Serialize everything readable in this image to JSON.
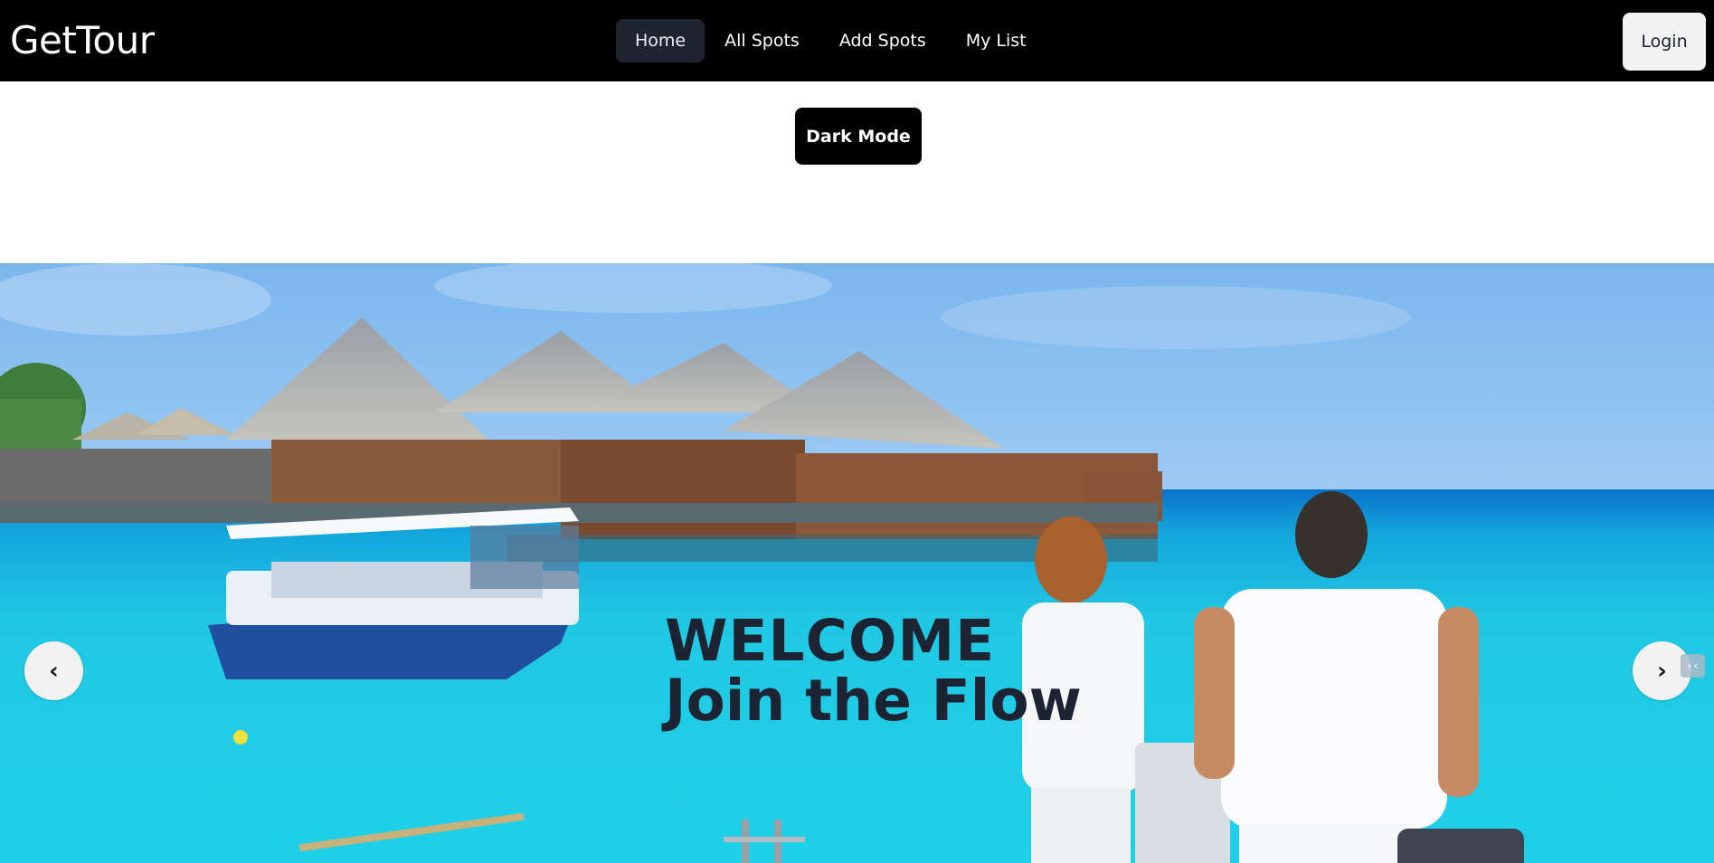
{
  "brand": {
    "name": "GetTour"
  },
  "nav": {
    "links": [
      {
        "label": "Home",
        "active": true
      },
      {
        "label": "All Spots",
        "active": false
      },
      {
        "label": "Add Spots",
        "active": false
      },
      {
        "label": "My List",
        "active": false
      }
    ],
    "login_label": "Login"
  },
  "theme_toggle": {
    "label": "Dark Mode"
  },
  "hero": {
    "line1": "WELCOME",
    "line2": "Join the Flow",
    "prev_glyph": "‹",
    "next_glyph": "›",
    "corner_glyph": "›‹"
  },
  "colors": {
    "navbar_bg": "#000000",
    "active_tab_bg": "#1f2430",
    "hero_text": "#1c2333",
    "sea": "#1fc6e0",
    "sky": "#6aaff0"
  },
  "icons": {
    "prev": "chevron-left-icon",
    "next": "chevron-right-icon"
  }
}
